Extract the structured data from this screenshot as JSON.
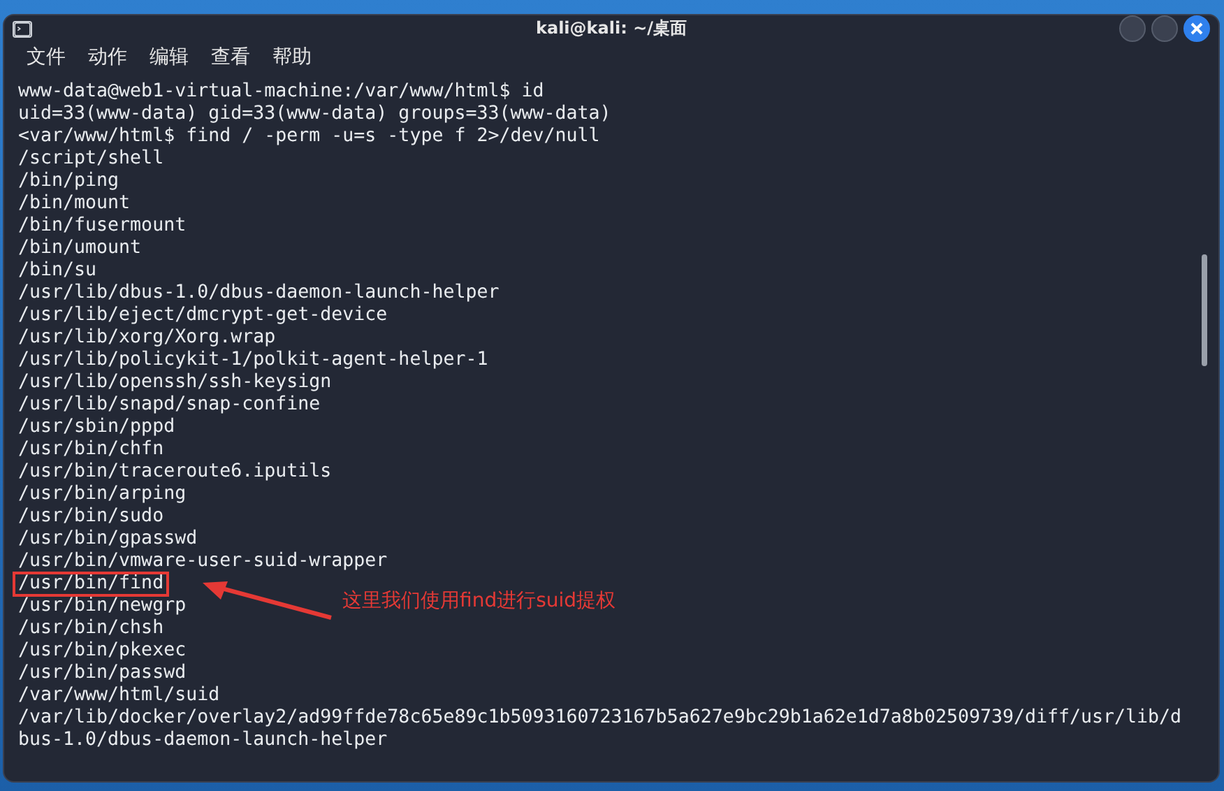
{
  "window": {
    "title": "kali@kali: ~/桌面"
  },
  "menu": [
    {
      "label": "文件"
    },
    {
      "label": "动作"
    },
    {
      "label": "编辑"
    },
    {
      "label": "查看"
    },
    {
      "label": "帮助"
    }
  ],
  "terminal": {
    "lines": [
      {
        "text": "www-data@web1-virtual-machine:/var/www/html$ id",
        "highlighted": false
      },
      {
        "text": "uid=33(www-data) gid=33(www-data) groups=33(www-data)",
        "highlighted": false
      },
      {
        "text": "<var/www/html$ find / -perm -u=s -type f 2>/dev/null",
        "highlighted": false
      },
      {
        "text": "/script/shell",
        "highlighted": false
      },
      {
        "text": "/bin/ping",
        "highlighted": false
      },
      {
        "text": "/bin/mount",
        "highlighted": false
      },
      {
        "text": "/bin/fusermount",
        "highlighted": false
      },
      {
        "text": "/bin/umount",
        "highlighted": false
      },
      {
        "text": "/bin/su",
        "highlighted": false
      },
      {
        "text": "/usr/lib/dbus-1.0/dbus-daemon-launch-helper",
        "highlighted": false
      },
      {
        "text": "/usr/lib/eject/dmcrypt-get-device",
        "highlighted": false
      },
      {
        "text": "/usr/lib/xorg/Xorg.wrap",
        "highlighted": false
      },
      {
        "text": "/usr/lib/policykit-1/polkit-agent-helper-1",
        "highlighted": false
      },
      {
        "text": "/usr/lib/openssh/ssh-keysign",
        "highlighted": false
      },
      {
        "text": "/usr/lib/snapd/snap-confine",
        "highlighted": false
      },
      {
        "text": "/usr/sbin/pppd",
        "highlighted": false
      },
      {
        "text": "/usr/bin/chfn",
        "highlighted": false
      },
      {
        "text": "/usr/bin/traceroute6.iputils",
        "highlighted": false
      },
      {
        "text": "/usr/bin/arping",
        "highlighted": false
      },
      {
        "text": "/usr/bin/sudo",
        "highlighted": false
      },
      {
        "text": "/usr/bin/gpasswd",
        "highlighted": false
      },
      {
        "text": "/usr/bin/vmware-user-suid-wrapper",
        "highlighted": false
      },
      {
        "text": "/usr/bin/find",
        "highlighted": true
      },
      {
        "text": "/usr/bin/newgrp",
        "highlighted": false
      },
      {
        "text": "/usr/bin/chsh",
        "highlighted": false
      },
      {
        "text": "/usr/bin/pkexec",
        "highlighted": false
      },
      {
        "text": "/usr/bin/passwd",
        "highlighted": false
      },
      {
        "text": "/var/www/html/suid",
        "highlighted": false
      },
      {
        "text": "/var/lib/docker/overlay2/ad99ffde78c65e89c1b5093160723167b5a627e9bc29b1a62e1d7a8b02509739/diff/usr/lib/d",
        "highlighted": false
      },
      {
        "text": "bus-1.0/dbus-daemon-launch-helper",
        "highlighted": false
      }
    ]
  },
  "annotation": {
    "text": "这里我们使用find进行suid提权"
  }
}
